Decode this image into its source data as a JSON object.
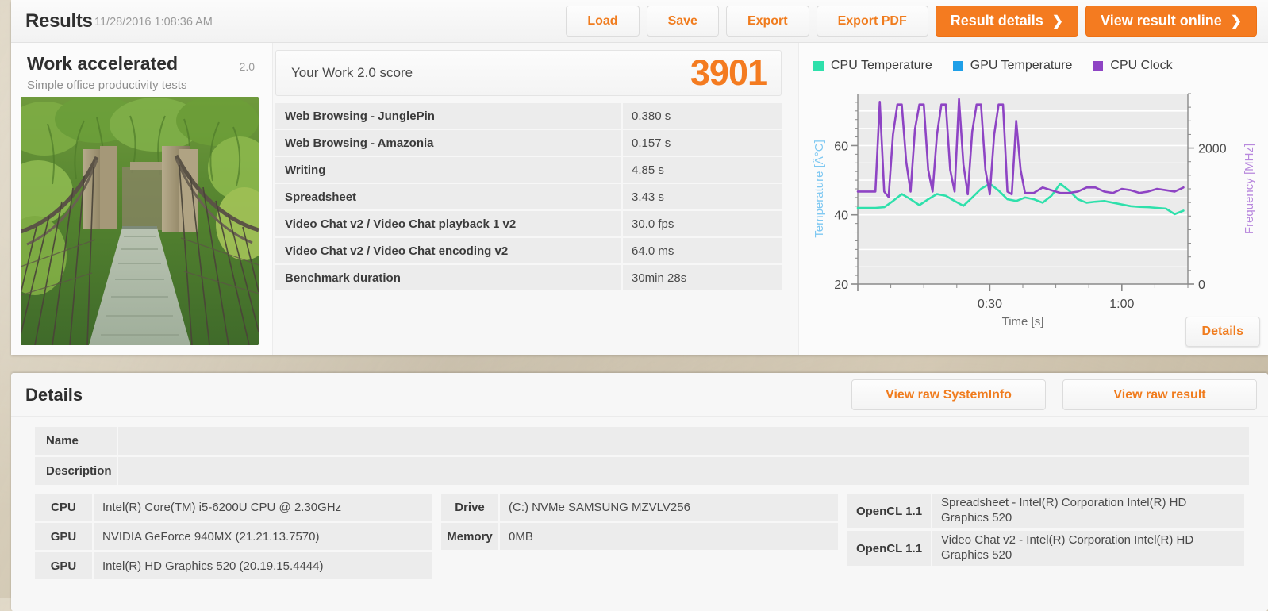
{
  "header": {
    "title": "Results",
    "date": "11/28/2016 1:08:36 AM",
    "buttons": [
      {
        "label": "Load",
        "style": "light"
      },
      {
        "label": "Save",
        "style": "light"
      },
      {
        "label": "Export",
        "style": "light"
      },
      {
        "label": "Export PDF",
        "style": "light"
      }
    ],
    "primary_buttons": [
      {
        "label": "Result details",
        "chevron": "❯"
      },
      {
        "label": "View result online",
        "chevron": "❯"
      }
    ]
  },
  "benchmark": {
    "name": "Work accelerated",
    "version": "2.0",
    "description": "Simple office productivity tests",
    "thumbnail_name": "suspension-bridge-photo"
  },
  "score": {
    "label": "Your Work 2.0 score",
    "value": "3901",
    "accent_color": "#f47b20"
  },
  "results_table": [
    {
      "name": "Web Browsing - JunglePin",
      "value": "0.380 s"
    },
    {
      "name": "Web Browsing - Amazonia",
      "value": "0.157 s"
    },
    {
      "name": "Writing",
      "value": "4.85 s"
    },
    {
      "name": "Spreadsheet",
      "value": "3.43 s"
    },
    {
      "name": "Video Chat v2 / Video Chat playback 1 v2",
      "value": "30.0 fps"
    },
    {
      "name": "Video Chat v2 / Video Chat encoding v2",
      "value": "64.0 ms"
    },
    {
      "name": "Benchmark duration",
      "value": "30min 28s"
    }
  ],
  "chart_panel": {
    "details_button": "Details"
  },
  "chart_data": {
    "type": "line",
    "title": "",
    "xlabel": "Time [s]",
    "ylabel": "Temperature [Â°C]",
    "y2label": "Frequency [MHz]",
    "xlim": [
      0,
      75
    ],
    "ylim": [
      20,
      75
    ],
    "y2lim": [
      0,
      2800
    ],
    "ytick_labels": [
      "60",
      "40",
      "20"
    ],
    "ytick_values": [
      60,
      40,
      20
    ],
    "y2tick_labels": [
      "2000",
      "0"
    ],
    "y2tick_values": [
      2000,
      0
    ],
    "xtick_labels": [
      "0:30",
      "1:00"
    ],
    "xtick_values": [
      30,
      60
    ],
    "grid": true,
    "legend_position": "top",
    "plot_background": "#ebebeb",
    "series": [
      {
        "name": "CPU Temperature",
        "color": "#2ee0ab",
        "axis": "left",
        "x": [
          0,
          2,
          4,
          6,
          8,
          10,
          12,
          14,
          16,
          18,
          20,
          22,
          24,
          26,
          28,
          30,
          32,
          34,
          36,
          38,
          40,
          42,
          44,
          46,
          48,
          50,
          52,
          54,
          56,
          58,
          60,
          62,
          64,
          66,
          68,
          70,
          72,
          74
        ],
        "values": [
          42,
          42,
          42,
          42.2,
          44,
          46,
          44.5,
          42.8,
          44.5,
          46,
          45.5,
          44,
          42.6,
          45,
          47.5,
          49,
          47,
          44.5,
          44,
          45,
          44.5,
          43.5,
          45.5,
          49,
          47,
          44.5,
          43.5,
          43.8,
          44,
          43.5,
          43,
          42.5,
          42.3,
          42.2,
          42,
          41.8,
          40.2,
          41.2
        ]
      },
      {
        "name": "GPU Temperature",
        "color": "#1e9fe8",
        "axis": "left",
        "x": [],
        "values": []
      },
      {
        "name": "CPU Clock",
        "color": "#8e44c4",
        "axis": "right",
        "x": [
          0,
          2,
          4,
          5,
          6,
          7,
          8,
          9,
          10,
          11,
          12,
          13,
          14,
          15,
          16,
          17,
          18,
          19,
          20,
          21,
          22,
          23,
          24,
          25,
          26,
          27,
          28,
          29,
          30,
          31,
          32,
          33,
          34,
          35,
          36,
          37,
          38,
          39,
          40,
          42,
          44,
          46,
          48,
          50,
          52,
          54,
          56,
          58,
          60,
          62,
          64,
          66,
          68,
          70,
          72,
          74
        ],
        "values": [
          34,
          34,
          34,
          67,
          34,
          32,
          55,
          66,
          66,
          45,
          34,
          57,
          66,
          66,
          42,
          34,
          55,
          66,
          66,
          42,
          34,
          68,
          44,
          33,
          56,
          66,
          66,
          42,
          33,
          55,
          66,
          66,
          34,
          33,
          60,
          42,
          33.5,
          33.5,
          33.5,
          35.5,
          34.5,
          33.5,
          33.5,
          34,
          35.5,
          35.5,
          34,
          33.5,
          35,
          34.5,
          33.5,
          34,
          35,
          34.5,
          34,
          35.5
        ]
      }
    ]
  },
  "details": {
    "title": "Details",
    "buttons": [
      {
        "label": "View raw SystemInfo"
      },
      {
        "label": "View raw result"
      }
    ],
    "name_description": [
      {
        "key": "Name",
        "value": ""
      },
      {
        "key": "Description",
        "value": ""
      }
    ],
    "hardware": [
      {
        "key": "CPU",
        "value": "Intel(R) Core(TM) i5-6200U CPU @ 2.30GHz"
      },
      {
        "key": "GPU",
        "value": "NVIDIA GeForce 940MX (21.21.13.7570)"
      },
      {
        "key": "GPU",
        "value": "Intel(R) HD Graphics 520 (20.19.15.4444)"
      }
    ],
    "storage": [
      {
        "key": "Drive",
        "value": "(C:) NVMe SAMSUNG MZVLV256"
      },
      {
        "key": "Memory",
        "value": "0MB"
      }
    ],
    "opencl": [
      {
        "key": "OpenCL 1.1",
        "value": "Spreadsheet - Intel(R) Corporation Intel(R) HD Graphics 520"
      },
      {
        "key": "OpenCL 1.1",
        "value": "Video Chat v2 - Intel(R) Corporation Intel(R) HD Graphics 520"
      }
    ]
  }
}
